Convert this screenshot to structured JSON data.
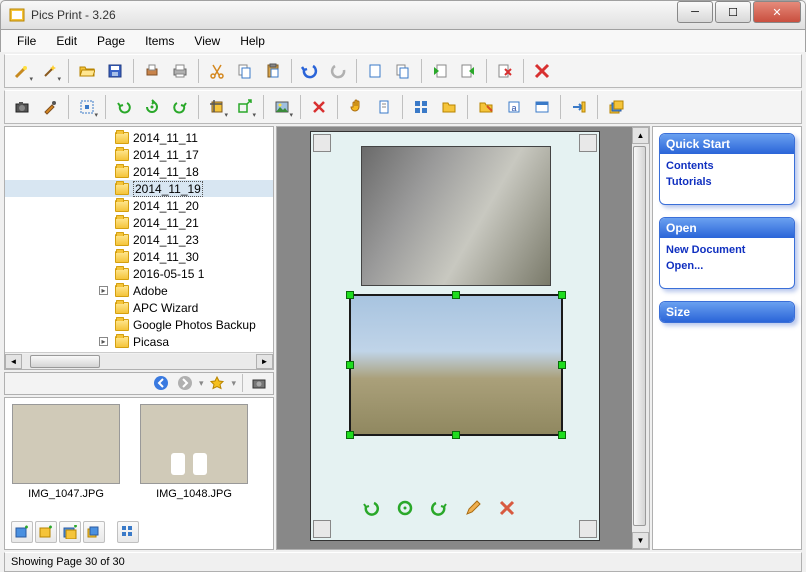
{
  "window": {
    "title": "Pics Print - 3.26"
  },
  "menu": {
    "file": "File",
    "edit": "Edit",
    "page": "Page",
    "items": "Items",
    "view": "View",
    "help": "Help"
  },
  "tree": {
    "items": [
      {
        "label": "2014_11_11",
        "sel": false
      },
      {
        "label": "2014_11_17",
        "sel": false
      },
      {
        "label": "2014_11_18",
        "sel": false
      },
      {
        "label": "2014_11_19",
        "sel": true
      },
      {
        "label": "2014_11_20",
        "sel": false
      },
      {
        "label": "2014_11_21",
        "sel": false
      },
      {
        "label": "2014_11_23",
        "sel": false
      },
      {
        "label": "2014_11_30",
        "sel": false
      },
      {
        "label": "2016-05-15 1",
        "sel": false
      },
      {
        "label": "Adobe",
        "sel": false,
        "expandable": true
      },
      {
        "label": "APC Wizard",
        "sel": false
      },
      {
        "label": "Google Photos Backup",
        "sel": false
      },
      {
        "label": "Picasa",
        "sel": false,
        "expandable": true
      }
    ]
  },
  "thumbs": [
    {
      "caption": "IMG_1047.JPG",
      "style": "wall"
    },
    {
      "caption": "IMG_1048.JPG",
      "style": "interior"
    }
  ],
  "panels": {
    "quickstart": {
      "title": "Quick Start",
      "links": [
        "Contents",
        "Tutorials"
      ]
    },
    "open": {
      "title": "Open",
      "links": [
        "New Document",
        "Open..."
      ]
    },
    "size": {
      "title": "Size",
      "links": []
    }
  },
  "status": {
    "text": "Showing Page 30 of 30"
  },
  "icons": {
    "wizard": "wizard",
    "magic": "magic",
    "folderopen": "folderopen",
    "save": "save",
    "printsetup": "printsetup",
    "print": "print",
    "cut": "cut",
    "copy": "copy",
    "paste": "paste",
    "undo": "undo",
    "redo": "redo",
    "newpage": "newpage",
    "duppage": "duppage",
    "prevpage": "prevpage",
    "nextpage": "nextpage",
    "delsel": "delsel",
    "delpage": "delpage",
    "camera": "camera",
    "eyedrop": "eyedrop",
    "select": "select",
    "rotl": "rotl",
    "rotrefresh": "rotrefresh",
    "rotr": "rotr",
    "crop": "crop",
    "resize": "resize",
    "image": "image",
    "delimg": "delimg",
    "hand": "hand",
    "page": "page",
    "grid": "grid",
    "folder": "folder",
    "editfolder": "editfolder",
    "text": "text",
    "props": "props",
    "export": "export",
    "stack": "stack"
  }
}
